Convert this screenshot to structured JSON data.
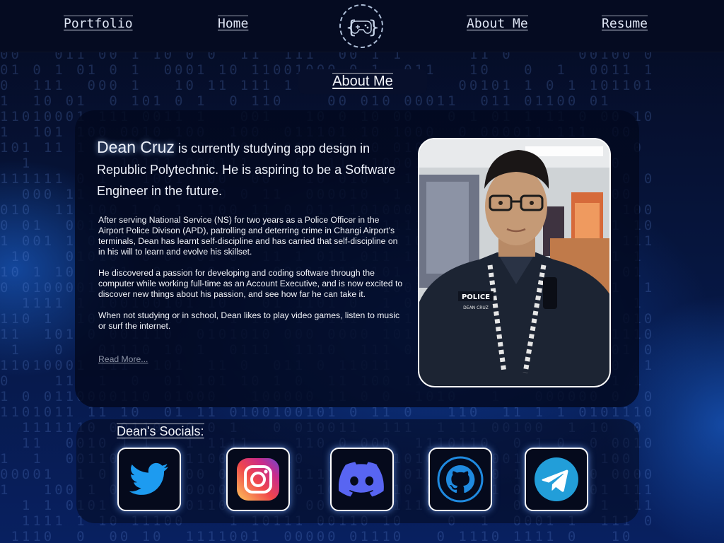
{
  "nav": {
    "portfolio": "Portfolio",
    "home": "Home",
    "about": "About Me",
    "resume": "Resume",
    "logo_icon": "gamepad-braces-logo-icon"
  },
  "section_title": "About Me",
  "intro": {
    "name": "Dean Cruz",
    "text": " is currently studying app design in Republic Polytechnic. He is aspiring to be a Software Engineer in the future."
  },
  "bio": [
    "After serving National Service (NS) for two years as a Police Officer in the Airport Police Divison (APD), patrolling and deterring crime in Changi Airport’s terminals, Dean has learnt self-discipline and has carried that self-discipline on in his will to learn and evolve his skillset.",
    "He discovered a passion for developing and coding software through the computer while working full-time as an Account Executive, and is now excited to discover new things about his passion, and see how far he can take it.",
    "When not studying or in school, Dean likes to play video games, listen to music or surf the internet."
  ],
  "read_more": "Read More...",
  "photo": {
    "icon": "profile-photo",
    "uniform_text": "POLICE",
    "name_tag": "DEAN CRUZ"
  },
  "socials": {
    "title": "Dean's Socials:",
    "items": [
      {
        "name": "twitter",
        "icon": "twitter-icon",
        "color": "#1d9bf0"
      },
      {
        "name": "instagram",
        "icon": "instagram-icon",
        "color": "#e1306c"
      },
      {
        "name": "discord",
        "icon": "discord-icon",
        "color": "#5865f2"
      },
      {
        "name": "github",
        "icon": "github-icon",
        "color": "#1f8ae0"
      },
      {
        "name": "telegram",
        "icon": "telegram-icon",
        "color": "#229ed9"
      }
    ]
  },
  "colors": {
    "background": "#06143a",
    "nav": "#050b21",
    "card": "#03091e",
    "accent_glow": "#78aaff"
  }
}
